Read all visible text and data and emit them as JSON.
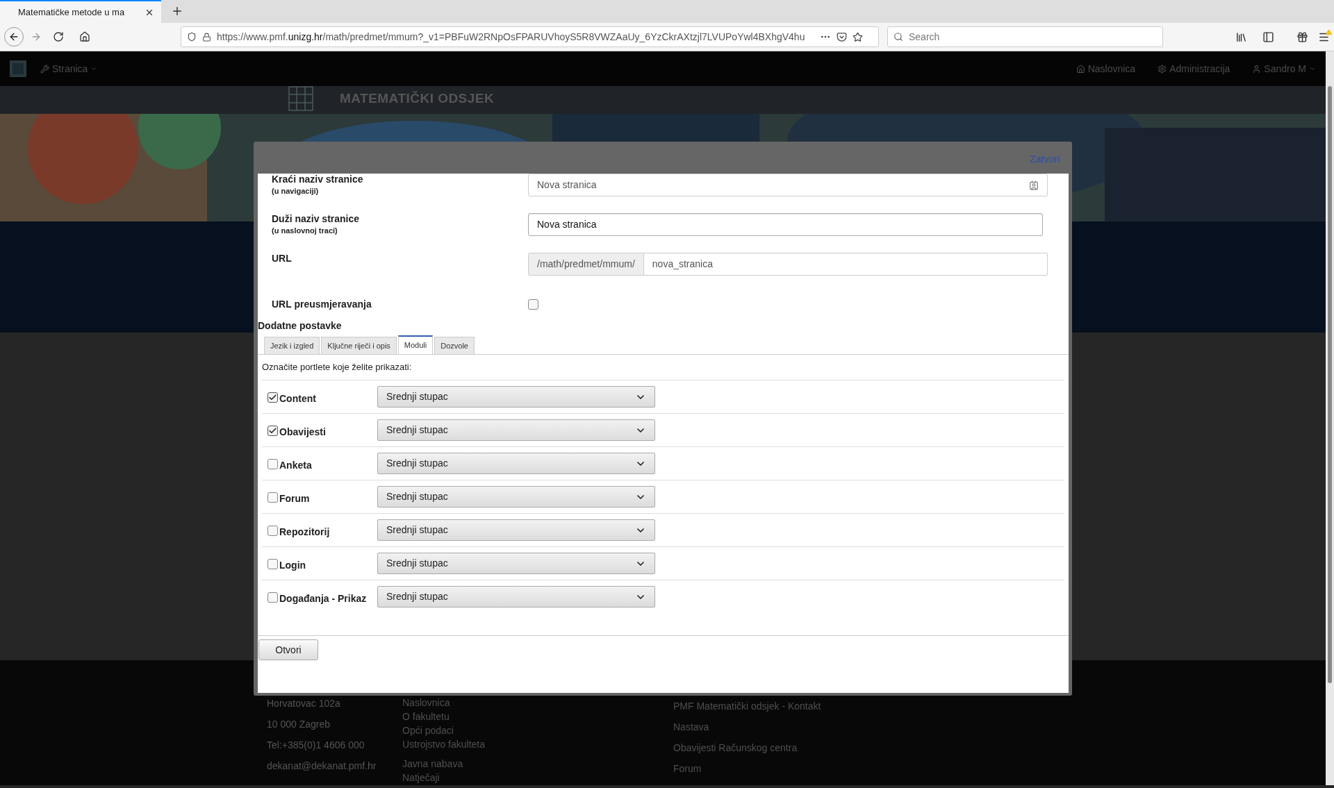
{
  "browser": {
    "tab_title": "Matematičke metode u ma",
    "url_prefix": "https://www.pmf.",
    "url_domain": "unizg.hr",
    "url_rest": "/math/predmet/mmum?_v1=PBFuW2RNpOsFPARUVhoyS5R8VWZAaUy_6YzCkrAXtzjl7LVUPoYwl4BXhgV4hu",
    "search_placeholder": "Search"
  },
  "navbar": {
    "menu": "Stranica",
    "links": [
      "Naslovnica",
      "Administracija",
      "Sandro M"
    ]
  },
  "header": {
    "title": "MATEMATIČKI ODSJEK"
  },
  "footer": {
    "column_1": [
      "Horvatovac 102a",
      "10 000 Zagreb",
      "Tel:+385(0)1 4606 000",
      "dekanat@dekanat.pmf.hr"
    ],
    "column_2": [
      "Naslovnica",
      "O fakultetu",
      "Opći podaci",
      "Ustrojstvo fakulteta",
      "Javna nabava",
      "Natječaji"
    ],
    "column_3": [
      "PMF Matematički odsjek - Kontakt",
      "Nastava",
      "Obavijesti Računskog centra",
      "Forum"
    ]
  },
  "dialog": {
    "close": "Zatvori",
    "fields": [
      {
        "kind": "text",
        "label": "Kraći naziv stranice",
        "hint": "(u navigaciji)",
        "value": "Nova stranica",
        "disabled": true
      },
      {
        "kind": "text",
        "label": "Duži naziv stranice",
        "hint": "(u naslovnoj traci)",
        "value": "Nova stranica",
        "disabled": false
      },
      {
        "kind": "url",
        "label": "URL",
        "prefix": "/math/predmet/mmum/",
        "value": "nova_stranica"
      },
      {
        "kind": "checkbox",
        "label": "URL preusmjeravanja",
        "checked": false
      }
    ],
    "section_title": "Dodatne postavke",
    "tabs": [
      {
        "label": "Jezik i izgled",
        "selected": false
      },
      {
        "label": "Ključne riječi i opis",
        "selected": false
      },
      {
        "label": "Moduli",
        "selected": true
      },
      {
        "label": "Dozvole",
        "selected": false
      }
    ],
    "instruction": "Označite portlete koje želite prikazati:",
    "modules": [
      {
        "name": "Content",
        "checked": true,
        "position": "Srednji stupac"
      },
      {
        "name": "Obavijesti",
        "checked": true,
        "position": "Srednji stupac"
      },
      {
        "name": "Anketa",
        "checked": false,
        "position": "Srednji stupac"
      },
      {
        "name": "Forum",
        "checked": false,
        "position": "Srednji stupac"
      },
      {
        "name": "Repozitorij",
        "checked": false,
        "position": "Srednji stupac"
      },
      {
        "name": "Login",
        "checked": false,
        "position": "Srednji stupac"
      },
      {
        "name": "Događanja - Prikaz",
        "checked": false,
        "position": "Srednji stupac"
      }
    ],
    "submit": "Otvori"
  }
}
